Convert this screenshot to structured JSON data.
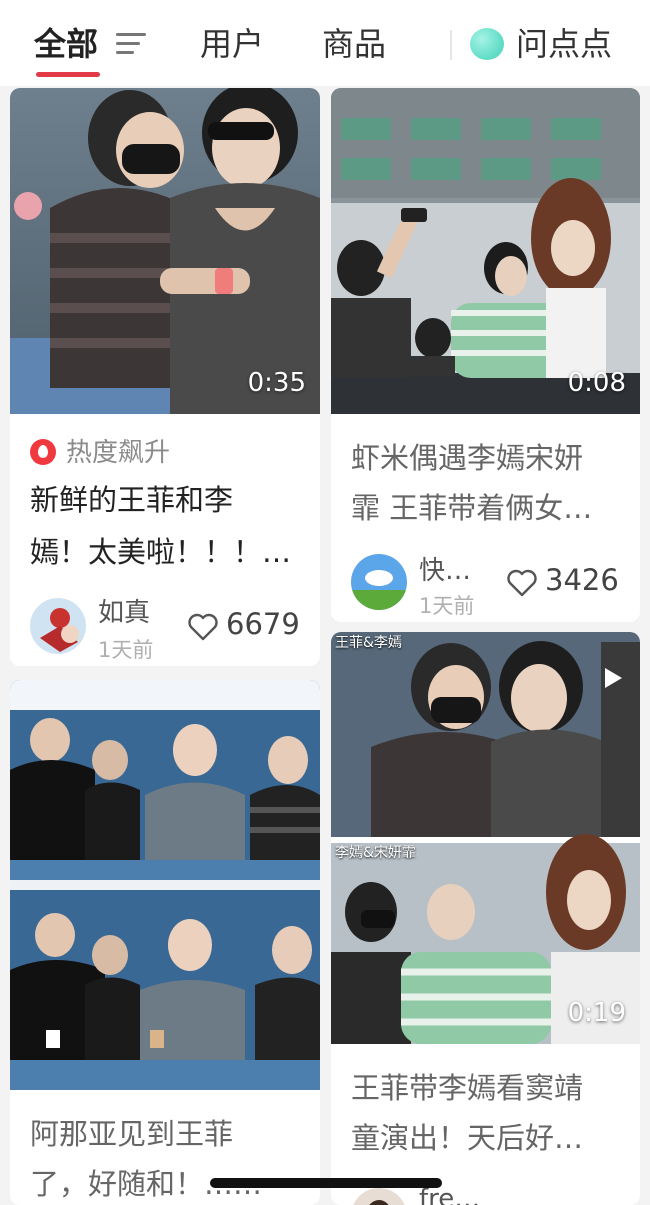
{
  "tabs": {
    "all": "全部",
    "users": "用户",
    "products": "商品",
    "ask": "问点点"
  },
  "cards": {
    "c1": {
      "duration": "0:35",
      "hot_label": "热度飙升",
      "title_line1": "新鲜的王菲和李",
      "title_line2": "嫣！太美啦！！！…",
      "author": "如真",
      "time": "1天前",
      "likes": "6679"
    },
    "c2": {
      "duration": "0:08",
      "title_line1": "虾米偶遇李嫣宋妍",
      "title_line2": "霏 王菲带着俩女…",
      "author": "快…",
      "time": "1天前",
      "likes": "3426"
    },
    "c3": {
      "title_line1": "阿那亚见到王菲",
      "title_line2": "了，好随和！……"
    },
    "c4": {
      "top_caption": "王菲&李嫣",
      "bottom_caption": "李嫣&宋妍霏",
      "duration": "0:19",
      "title_line1": "王菲带李嫣看窦靖",
      "title_line2": "童演出！天后好…",
      "author": "fre…"
    }
  },
  "colors": {
    "accent": "#e23b47",
    "hot": "#f0383f",
    "ai": "#5ddbc4"
  },
  "icons": [
    "filter-icon",
    "ai-assistant-icon",
    "fire-icon",
    "heart-icon",
    "play-icon"
  ]
}
